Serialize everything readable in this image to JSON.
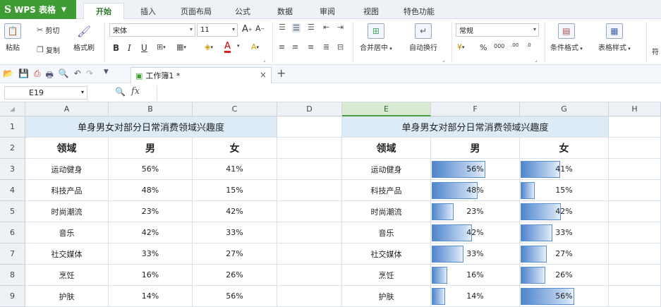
{
  "app": {
    "name": "WPS 表格"
  },
  "tabs": [
    {
      "label": "开始",
      "active": true
    },
    {
      "label": "插入"
    },
    {
      "label": "页面布局"
    },
    {
      "label": "公式"
    },
    {
      "label": "数据"
    },
    {
      "label": "审阅"
    },
    {
      "label": "视图"
    },
    {
      "label": "特色功能"
    }
  ],
  "ribbon": {
    "paste": "粘贴",
    "cut": "剪切",
    "copy": "复制",
    "format_painter": "格式刷",
    "font_name": "宋体",
    "font_size": "11",
    "merge_center": "合并居中",
    "wrap_text": "自动换行",
    "number_format": "常规",
    "percent": "%",
    "conditional_format": "条件格式",
    "table_style": "表格样式",
    "cut_off": "符",
    "bold": "B",
    "italic": "I",
    "underline": "U",
    "font_grow": "A",
    "font_shrink": "A",
    "font_color_letter": "A",
    "thousands": "000",
    "dec_inc": ".00",
    "dec_dec": ".0"
  },
  "document": {
    "tab_title": "工作簿1 *"
  },
  "formula": {
    "cell_ref": "E19",
    "fx": "fx",
    "value": ""
  },
  "columns": [
    "A",
    "B",
    "C",
    "D",
    "E",
    "F",
    "G",
    "H"
  ],
  "rows": [
    "1",
    "2",
    "3",
    "4",
    "5",
    "6",
    "7",
    "8",
    "9"
  ],
  "table": {
    "title": "单身男女对部分日常消费领域兴趣度",
    "headers": [
      "领域",
      "男",
      "女"
    ],
    "data": [
      {
        "field": "运动健身",
        "male": "56%",
        "female": "41%"
      },
      {
        "field": "科技产品",
        "male": "48%",
        "female": "15%"
      },
      {
        "field": "时尚潮流",
        "male": "23%",
        "female": "42%"
      },
      {
        "field": "音乐",
        "male": "42%",
        "female": "33%"
      },
      {
        "field": "社交媒体",
        "male": "33%",
        "female": "27%"
      },
      {
        "field": "烹饪",
        "male": "16%",
        "female": "26%"
      },
      {
        "field": "护肤",
        "male": "14%",
        "female": "56%"
      }
    ]
  },
  "table2": {
    "title": "单身男女对部分日常消费领域兴趣度",
    "headers": [
      "领域",
      "男",
      "女"
    ],
    "data": [
      {
        "field": "运动健身",
        "male": "56%",
        "female": "41%",
        "male_v": 56,
        "female_v": 41
      },
      {
        "field": "科技产品",
        "male": "48%",
        "female": "15%",
        "male_v": 48,
        "female_v": 15
      },
      {
        "field": "时尚潮流",
        "male": "23%",
        "female": "42%",
        "male_v": 23,
        "female_v": 42
      },
      {
        "field": "音乐",
        "male": "42%",
        "female": "33%",
        "male_v": 42,
        "female_v": 33
      },
      {
        "field": "社交媒体",
        "male": "33%",
        "female": "27%",
        "male_v": 33,
        "female_v": 27
      },
      {
        "field": "烹饪",
        "male": "16%",
        "female": "26%",
        "male_v": 16,
        "female_v": 26
      },
      {
        "field": "护肤",
        "male": "14%",
        "female": "56%",
        "male_v": 14,
        "female_v": 56
      }
    ],
    "bar_max": 56
  },
  "colors": {
    "accent_green": "#3f9c35",
    "title_fill": "#ddebf7",
    "bar_blue": "#4f84cc"
  }
}
